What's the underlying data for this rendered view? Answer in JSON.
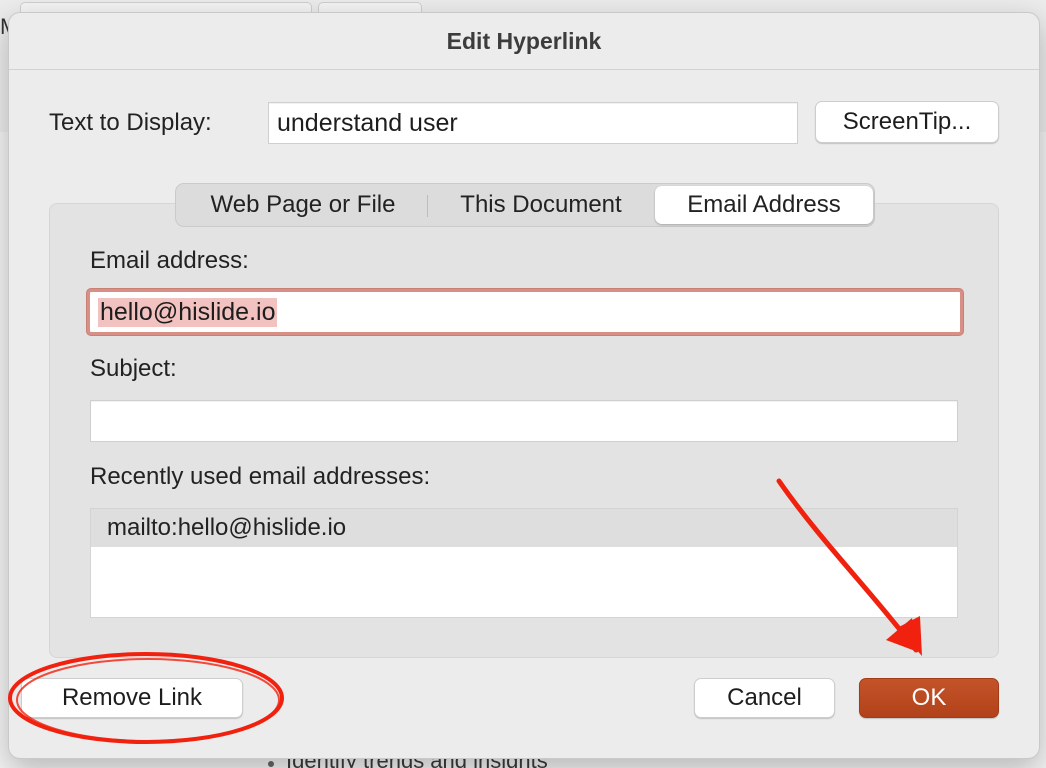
{
  "background": {
    "partial_char": "M",
    "bullet_text": "Identify trends and insights"
  },
  "dialog": {
    "title": "Edit Hyperlink",
    "text_to_display_label": "Text to Display:",
    "text_to_display_value": "understand user",
    "screentip_label": "ScreenTip...",
    "tabs": [
      {
        "label": "Web Page or File",
        "active": false
      },
      {
        "label": "This Document",
        "active": false
      },
      {
        "label": "Email Address",
        "active": true
      }
    ],
    "email_label": "Email address:",
    "email_value": "hello@hislide.io",
    "subject_label": "Subject:",
    "subject_value": "",
    "recent_label": "Recently used email addresses:",
    "recent_items": [
      "mailto:hello@hislide.io"
    ],
    "remove_link_label": "Remove Link",
    "cancel_label": "Cancel",
    "ok_label": "OK"
  },
  "colors": {
    "ok_button": "#b84a1f",
    "annotation_red": "#f0220f",
    "email_focus_ring": "#d88f85"
  },
  "icons": [
    "arrow-annotation-icon",
    "circle-annotation-icon"
  ]
}
